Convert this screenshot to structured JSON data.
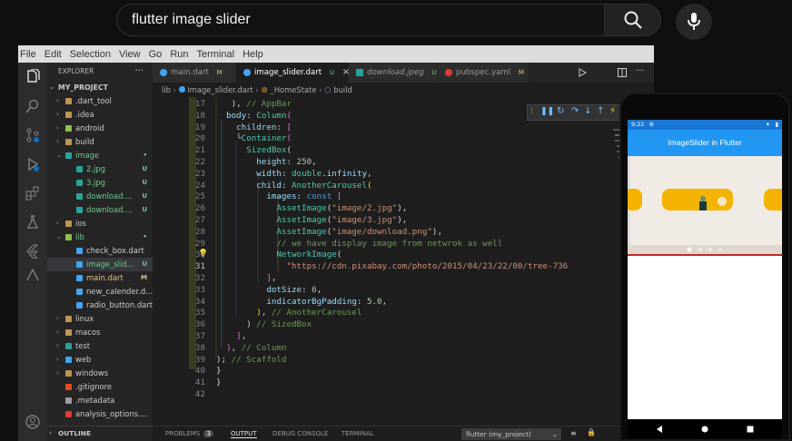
{
  "youtube": {
    "search_value": "flutter image slider"
  },
  "vscode": {
    "menu": [
      "File",
      "Edit",
      "Selection",
      "View",
      "Go",
      "Run",
      "Terminal",
      "Help"
    ],
    "explorer": {
      "header": "EXPLORER",
      "more": "···",
      "project": "MY_PROJECT",
      "items": [
        {
          "label": ".dart_tool",
          "depth": 1,
          "kind": "folder",
          "open": false,
          "badge": "",
          "color": "#c09553"
        },
        {
          "label": ".idea",
          "depth": 1,
          "kind": "folder",
          "open": false,
          "badge": "",
          "color": "#c09553"
        },
        {
          "label": "android",
          "depth": 1,
          "kind": "folder",
          "open": false,
          "badge": "",
          "color": "#8bc34a"
        },
        {
          "label": "build",
          "depth": 1,
          "kind": "folder",
          "open": false,
          "badge": "",
          "color": "#c09553"
        },
        {
          "label": "image",
          "depth": 1,
          "kind": "folder",
          "open": true,
          "badge": "•",
          "color": "#26a69a"
        },
        {
          "label": "2.jpg",
          "depth": 2,
          "kind": "file",
          "open": false,
          "badge": "U",
          "color": "#26a69a"
        },
        {
          "label": "3.jpg",
          "depth": 2,
          "kind": "file",
          "open": false,
          "badge": "U",
          "color": "#26a69a"
        },
        {
          "label": "download....",
          "depth": 2,
          "kind": "file",
          "open": false,
          "badge": "U",
          "color": "#26a69a"
        },
        {
          "label": "download....",
          "depth": 2,
          "kind": "file",
          "open": false,
          "badge": "U",
          "color": "#26a69a"
        },
        {
          "label": "ios",
          "depth": 1,
          "kind": "folder",
          "open": false,
          "badge": "",
          "color": "#c09553"
        },
        {
          "label": "lib",
          "depth": 1,
          "kind": "folder",
          "open": true,
          "badge": "•",
          "color": "#8bc34a"
        },
        {
          "label": "check_box.dart",
          "depth": 2,
          "kind": "file",
          "open": false,
          "badge": "",
          "color": "#42a5f5"
        },
        {
          "label": "image_slid...",
          "depth": 2,
          "kind": "file",
          "open": false,
          "badge": "U",
          "color": "#42a5f5",
          "selected": true
        },
        {
          "label": "main.dart",
          "depth": 2,
          "kind": "file",
          "open": false,
          "badge": "M",
          "color": "#42a5f5"
        },
        {
          "label": "new_calender.d...",
          "depth": 2,
          "kind": "file",
          "open": false,
          "badge": "",
          "color": "#42a5f5"
        },
        {
          "label": "radio_button.dart",
          "depth": 2,
          "kind": "file",
          "open": false,
          "badge": "",
          "color": "#42a5f5"
        },
        {
          "label": "linux",
          "depth": 1,
          "kind": "folder",
          "open": false,
          "badge": "",
          "color": "#c09553"
        },
        {
          "label": "macos",
          "depth": 1,
          "kind": "folder",
          "open": false,
          "badge": "",
          "color": "#c09553"
        },
        {
          "label": "test",
          "depth": 1,
          "kind": "folder",
          "open": false,
          "badge": "",
          "color": "#26a69a"
        },
        {
          "label": "web",
          "depth": 1,
          "kind": "folder",
          "open": false,
          "badge": "",
          "color": "#42a5f5"
        },
        {
          "label": "windows",
          "depth": 1,
          "kind": "folder",
          "open": false,
          "badge": "",
          "color": "#c09553"
        },
        {
          "label": ".gitignore",
          "depth": 1,
          "kind": "file",
          "open": false,
          "badge": "",
          "color": "#e64a19"
        },
        {
          "label": ".metadata",
          "depth": 1,
          "kind": "file",
          "open": false,
          "badge": "",
          "color": "#9e9e9e"
        },
        {
          "label": "analysis_options....",
          "depth": 1,
          "kind": "file",
          "open": false,
          "badge": "",
          "color": "#e53935"
        }
      ],
      "outline": "OUTLINE"
    },
    "tabs": [
      {
        "label": "main.dart",
        "mod": "M",
        "active": false,
        "italic": false,
        "color": "#42a5f5"
      },
      {
        "label": "image_slider.dart",
        "mod": "U",
        "active": true,
        "italic": false,
        "color": "#42a5f5",
        "close": "×"
      },
      {
        "label": "download.jpeg",
        "mod": "U",
        "active": false,
        "italic": true,
        "color": "#26a69a"
      },
      {
        "label": "pubspec.yaml",
        "mod": "M",
        "active": false,
        "italic": false,
        "color": "#e53935"
      }
    ],
    "breadcrumb": [
      "lib",
      "image_slider.dart",
      "_HomeState",
      "build"
    ],
    "code_lines": [
      {
        "n": "17",
        "html": "   ), <span class=\"c\">// AppBar</span>"
      },
      {
        "n": "18",
        "html": "  <span class=\"v\">body</span>: <span class=\"t\">Column</span><span class=\"pp\">(</span>"
      },
      {
        "n": "19",
        "html": "    <span class=\"v\">children</span>: <span class=\"pp\">[</span>"
      },
      {
        "n": "20",
        "html": "    └<span class=\"t\">Container</span><span class=\"pp\">(</span>"
      },
      {
        "n": "21",
        "html": "      <span class=\"t\">SizedBox</span>("
      },
      {
        "n": "22",
        "html": "        <span class=\"v\">height</span>: <span class=\"n\">250</span>,"
      },
      {
        "n": "23",
        "html": "        <span class=\"v\">width</span>: <span class=\"t\">double</span>.<span class=\"v\">infinity</span>,"
      },
      {
        "n": "24",
        "html": "        <span class=\"v\">child</span>: <span class=\"t\">AnotherCarousel</span><span class=\"p\">(</span>"
      },
      {
        "n": "25",
        "html": "          <span class=\"v\">images</span>: <span class=\"k\">const</span> <span class=\"pp\">[</span>"
      },
      {
        "n": "26",
        "html": "            <span class=\"t\">AssetImage</span>(<span class=\"s\">\"image/2.jpg\"</span>),"
      },
      {
        "n": "27",
        "html": "            <span class=\"t\">AssetImage</span>(<span class=\"s\">\"image/3.jpg\"</span>),"
      },
      {
        "n": "28",
        "html": "            <span class=\"t\">AssetImage</span>(<span class=\"s\">\"image/download.png\"</span>),"
      },
      {
        "n": "29",
        "html": "            <span class=\"c\">// we have display image from netwrok as well</span>"
      },
      {
        "n": "30",
        "html": "            <span class=\"t\">NetworkImage</span>("
      },
      {
        "n": "31",
        "html": "              <span class=\"s\">\"https://cdn.pixabay.com/photo/2015/04/23/22/00/tree-736</span>"
      },
      {
        "n": "32",
        "html": "          <span class=\"pp\">]</span>,"
      },
      {
        "n": "33",
        "html": "          <span class=\"v\">dotSize</span>: <span class=\"n\">6</span>,"
      },
      {
        "n": "34",
        "html": "          <span class=\"v\">indicatorBgPadding</span>: <span class=\"n\">5.0</span>,"
      },
      {
        "n": "35",
        "html": "        <span class=\"p\">)</span>, <span class=\"c\">// AnotherCarousel</span>"
      },
      {
        "n": "36",
        "html": "      ) <span class=\"c\">// SizedBox</span>"
      },
      {
        "n": "37",
        "html": "    <span class=\"pp\">]</span>,"
      },
      {
        "n": "38",
        "html": "  <span class=\"pp\">)</span>, <span class=\"c\">// Column</span>"
      },
      {
        "n": "39",
        "html": "); <span class=\"c\">// Scaffold</span>"
      },
      {
        "n": "40",
        "html": "}"
      },
      {
        "n": "41",
        "html": "}"
      },
      {
        "n": "42",
        "html": ""
      }
    ],
    "panel": {
      "tabs": [
        "PROBLEMS",
        "OUTPUT",
        "DEBUG CONSOLE",
        "TERMINAL"
      ],
      "problems_count": "3",
      "active": "OUTPUT",
      "select_value": "flutter (my_project)"
    }
  },
  "emulator": {
    "time": "9:22",
    "app_title": "ImageSlider in Flutter"
  }
}
